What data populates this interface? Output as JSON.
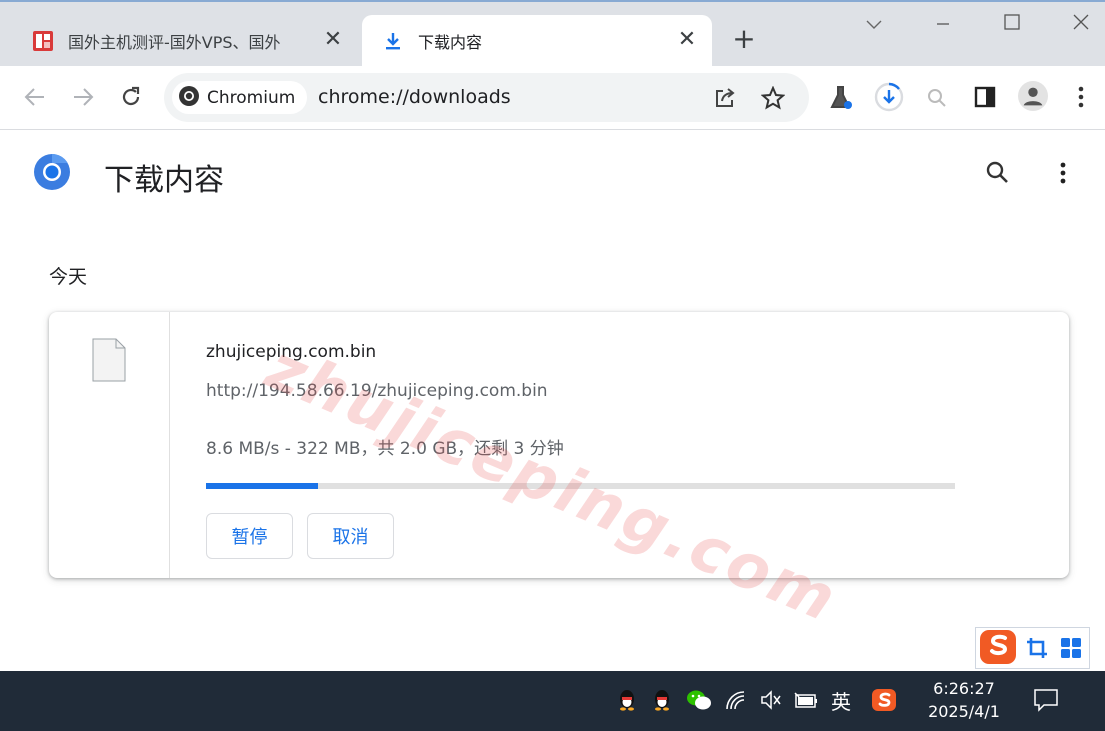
{
  "tabs": [
    {
      "title": "国外主机测评-国外VPS、国外",
      "close": "✕",
      "favicon": "site-logo-icon"
    },
    {
      "title": "下载内容",
      "close": "✕",
      "favicon": "download-icon"
    }
  ],
  "new_tab": "+",
  "window_controls": {
    "dropdown": "chevron-down-icon",
    "minimize": "minimize-icon",
    "maximize": "maximize-icon",
    "close": "close-icon"
  },
  "omnibox": {
    "chip_label": "Chromium",
    "url": "chrome://downloads"
  },
  "page": {
    "title": "下载内容",
    "section": "今天"
  },
  "download": {
    "file_name": "zhujiceping.com.bin",
    "url": "http://194.58.66.19/zhujiceping.com.bin",
    "status": "8.6 MB/s - 322 MB，共 2.0 GB，还剩 3 分钟",
    "progress_fraction": 0.15,
    "pause_label": "暂停",
    "cancel_label": "取消"
  },
  "watermark": "zhujiceping.com",
  "taskbar": {
    "time": "6:26:27",
    "date": "2025/4/1",
    "ime_lang": "英"
  },
  "colors": {
    "accent": "#1a73e8",
    "tab_strip": "#dee1e6",
    "taskbar": "#202b38",
    "sogou": "#f15a24"
  }
}
